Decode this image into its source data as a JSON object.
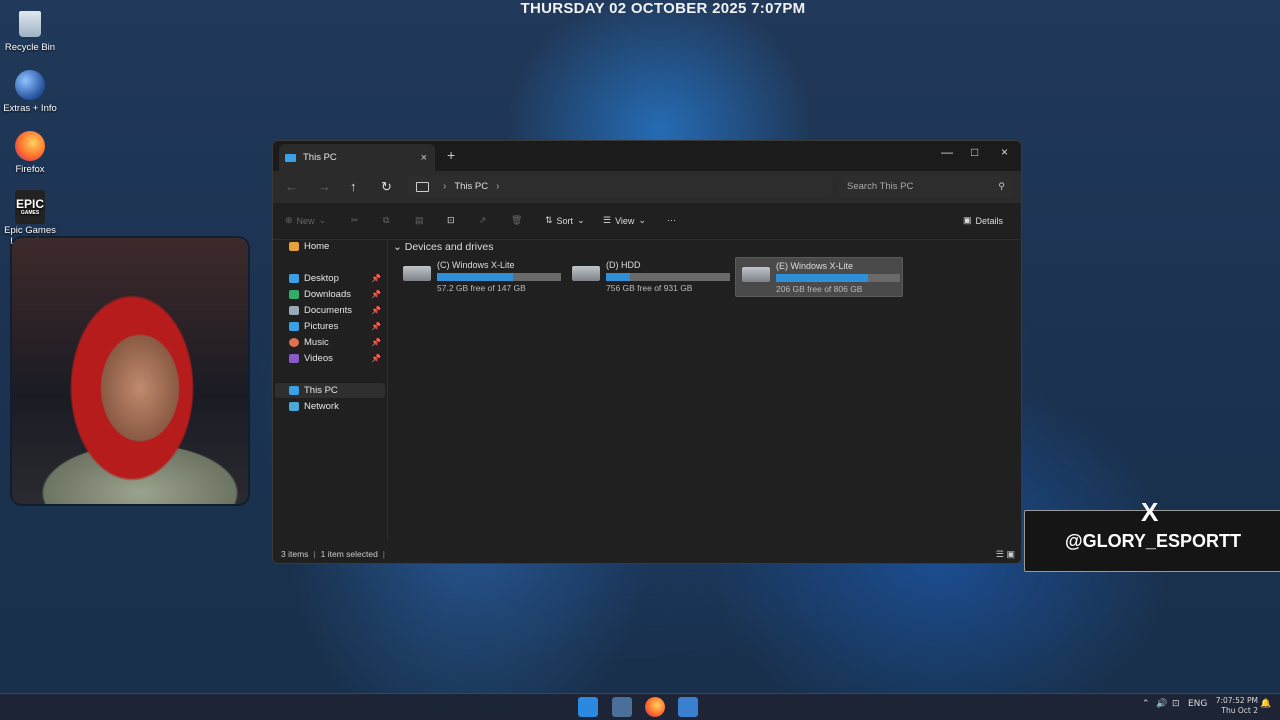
{
  "desktop": {
    "datetime": "THURSDAY 02 OCTOBER 2025 7:07PM",
    "icons": [
      {
        "label": "Recycle Bin",
        "icon": "recycle-bin-icon"
      },
      {
        "label": "Extras + Info",
        "icon": "globe-icon"
      },
      {
        "label": "Firefox",
        "icon": "firefox-icon"
      },
      {
        "label": "Epic Games Launcher",
        "icon": "epic-games-icon",
        "logo_text": "EPIC",
        "logo_sub": "GAMES"
      }
    ]
  },
  "explorer": {
    "tab_title": "This PC",
    "tab_close": "×",
    "new_tab": "+",
    "window_controls": {
      "minimize": "—",
      "maximize": "□",
      "close": "×"
    },
    "nav": {
      "back": "←",
      "forward": "→",
      "up": "↑",
      "refresh": "↻"
    },
    "breadcrumb": [
      "This PC"
    ],
    "search_placeholder": "Search This PC",
    "toolbar": {
      "new_label": "New",
      "sort_label": "Sort",
      "view_label": "View",
      "more_label": "···",
      "details_label": "Details"
    },
    "sidebar": {
      "home": "Home",
      "quick_access": [
        {
          "label": "Desktop",
          "icon": "desktop-folder-icon",
          "color": "#3aa0e8"
        },
        {
          "label": "Downloads",
          "icon": "download-icon",
          "color": "#2fae6a"
        },
        {
          "label": "Documents",
          "icon": "documents-icon",
          "color": "#9aa8b8"
        },
        {
          "label": "Pictures",
          "icon": "pictures-icon",
          "color": "#3aa0e8"
        },
        {
          "label": "Music",
          "icon": "music-icon",
          "color": "#e07050"
        },
        {
          "label": "Videos",
          "icon": "videos-icon",
          "color": "#8a58c8"
        }
      ],
      "this_pc": "This PC",
      "network": "Network"
    },
    "group_header": "Devices and drives",
    "drives": [
      {
        "name": "(C) Windows X-Lite",
        "free_text": "57.2 GB free of 147 GB",
        "used_fraction": 0.61,
        "selected": false
      },
      {
        "name": "(D) HDD",
        "free_text": "756 GB free of 931 GB",
        "used_fraction": 0.19,
        "selected": false
      },
      {
        "name": "(E) Windows X-Lite",
        "free_text": "206 GB free of 806 GB",
        "used_fraction": 0.74,
        "selected": true
      }
    ],
    "status": {
      "items": "3 items",
      "selected": "1 item selected"
    }
  },
  "social_badge": {
    "logo": "X",
    "handle": "@GLORY_ESPORTT"
  },
  "taskbar": {
    "apps": [
      "start-icon",
      "file-explorer-icon",
      "firefox-icon",
      "fortnite-icon"
    ],
    "tray_language": "ENG",
    "clock_time": "7:07:52 PM",
    "clock_date": "Thu Oct 2"
  }
}
